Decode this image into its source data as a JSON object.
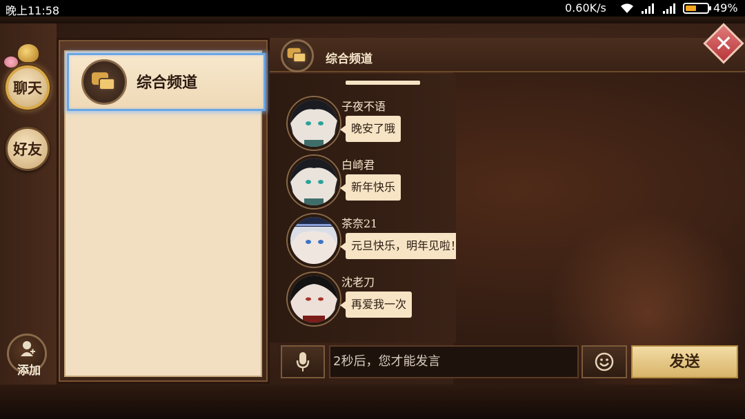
{
  "status_bar": {
    "time": "晚上11:58",
    "network_speed": "0.60K/s",
    "battery_percent": "49%",
    "battery_level": 0.49
  },
  "sidebar": {
    "tabs": [
      {
        "label": "聊天",
        "active": true
      },
      {
        "label": "好友",
        "active": false
      }
    ],
    "add_label": "添加"
  },
  "channel_list": {
    "items": [
      {
        "label": "综合频道",
        "selected": true
      }
    ]
  },
  "chat": {
    "header_title": "综合频道",
    "messages": [
      {
        "name": "子夜不语",
        "text": "晚安了哦",
        "avatar": "avatar-dark-hair-green-eyes"
      },
      {
        "name": "白崎君",
        "text": "新年快乐",
        "avatar": "avatar-dark-hair-green-eyes"
      },
      {
        "name": "茶奈21",
        "text": "元旦快乐，明年见啦！",
        "avatar": "avatar-white-hair-blue-eyes"
      },
      {
        "name": "沈老刀",
        "text": "再爱我一次",
        "avatar": "avatar-black-hair-red-eyes"
      }
    ]
  },
  "input": {
    "placeholder": "2秒后，您才能发言",
    "send_label": "发送",
    "mic_icon": "microphone-icon",
    "emoji_icon": "smiley-icon"
  },
  "colors": {
    "panel_bg": "#f2dfc2",
    "selected_border": "#6aa6e4",
    "send_button": "#e6c887",
    "close_button": "#c9474a"
  }
}
